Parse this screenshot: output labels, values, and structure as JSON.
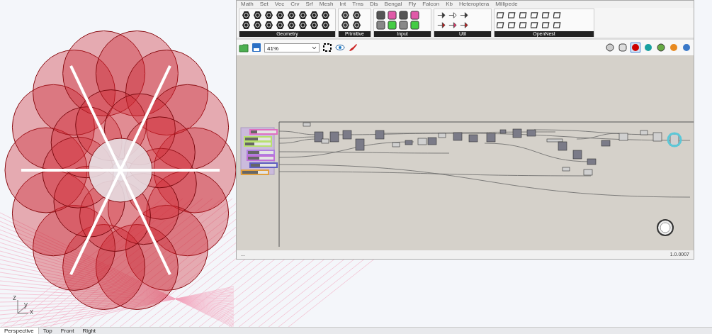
{
  "viewport": {
    "axis_labels": [
      "z",
      "y",
      "x"
    ],
    "tabs": [
      {
        "label": "Perspective",
        "selected": true
      },
      {
        "label": "Top",
        "selected": false
      },
      {
        "label": "Front",
        "selected": false
      },
      {
        "label": "Right",
        "selected": false
      }
    ]
  },
  "grasshopper": {
    "ribbon_tabs": [
      {
        "label": "Math",
        "selected": false
      },
      {
        "label": "Set",
        "selected": false
      },
      {
        "label": "Vec",
        "selected": false
      },
      {
        "label": "Crv",
        "selected": false
      },
      {
        "label": "Srf",
        "selected": false
      },
      {
        "label": "Mesh",
        "selected": false
      },
      {
        "label": "Int",
        "selected": false
      },
      {
        "label": "Trns",
        "selected": false
      },
      {
        "label": "Dis",
        "selected": false
      },
      {
        "label": "Bengal",
        "selected": false
      },
      {
        "label": "Fly",
        "selected": false
      },
      {
        "label": "Falcon",
        "selected": false
      },
      {
        "label": "Kb",
        "selected": false
      },
      {
        "label": "Heteroptera",
        "selected": false
      },
      {
        "label": "Millipede",
        "selected": false
      }
    ],
    "panels": [
      {
        "label": "Geometry"
      },
      {
        "label": "Primitive"
      },
      {
        "label": "Input"
      },
      {
        "label": "Util"
      },
      {
        "label": "OpenNest"
      }
    ],
    "zoom": "41%",
    "sliders": [
      {
        "color": "#e070c0",
        "level": 0.25
      },
      {
        "color": "#b8e070",
        "level": 0.5
      },
      {
        "color": "#b8e070",
        "level": 0.35
      },
      {
        "color": "#b080e0",
        "level": 0.45
      },
      {
        "color": "#c070d8",
        "level": 0.45
      },
      {
        "color": "#6060c0",
        "level": 0.35
      },
      {
        "color": "#e0a040",
        "level": 0.6
      }
    ],
    "status": {
      "left": "...",
      "version": "1.0.0007"
    }
  }
}
